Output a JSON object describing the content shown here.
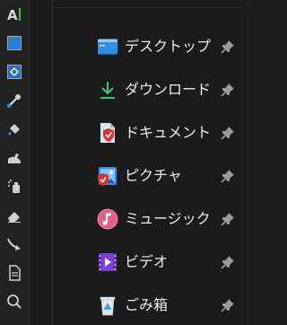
{
  "toolbar": {
    "tools": [
      {
        "name": "text-tool-icon"
      },
      {
        "name": "rectangle-select-icon"
      },
      {
        "name": "transform-icon"
      },
      {
        "name": "color-picker-icon"
      },
      {
        "name": "fill-bucket-icon"
      },
      {
        "name": "smudge-icon"
      },
      {
        "name": "airbrush-icon"
      },
      {
        "name": "eraser-icon"
      },
      {
        "name": "path-tool-icon"
      },
      {
        "name": "document-icon"
      },
      {
        "name": "zoom-icon"
      }
    ]
  },
  "quick_access": {
    "items": [
      {
        "label": "デスクトップ",
        "icon": "desktop-icon",
        "pinned": true
      },
      {
        "label": "ダウンロード",
        "icon": "download-icon",
        "pinned": true
      },
      {
        "label": "ドキュメント",
        "icon": "documents-icon",
        "pinned": true
      },
      {
        "label": "ピクチャ",
        "icon": "pictures-icon",
        "pinned": true
      },
      {
        "label": "ミュージック",
        "icon": "music-icon",
        "pinned": true
      },
      {
        "label": "ビデオ",
        "icon": "videos-icon",
        "pinned": true
      },
      {
        "label": "ごみ箱",
        "icon": "recycle-bin-icon",
        "pinned": true
      }
    ]
  },
  "colors": {
    "background": "#1b1b1b",
    "text": "#ececec",
    "pin": "#9a9a9a",
    "accent_green": "#3fbf7f",
    "accent_blue": "#2f8fe8"
  }
}
